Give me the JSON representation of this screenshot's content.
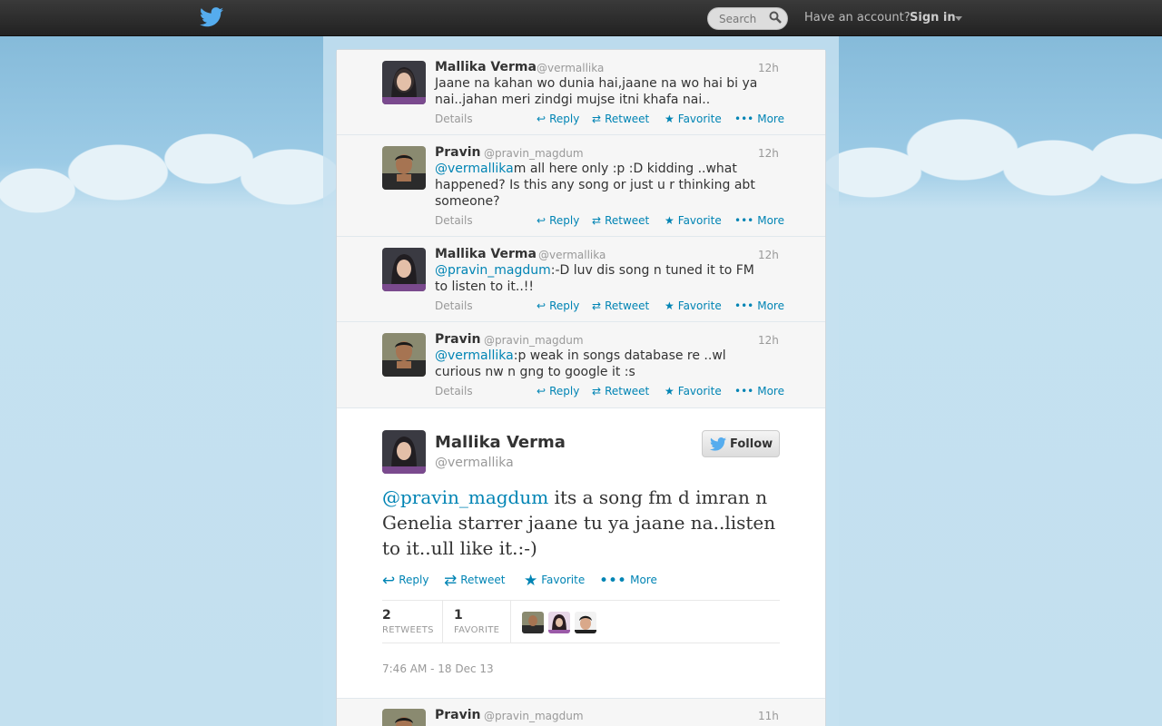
{
  "header": {
    "search_placeholder": "Search",
    "have_account": "Have an account?",
    "signin_label": "Sign in"
  },
  "colors": {
    "link": "#0084b4",
    "topbar": "#2a2a2a"
  },
  "tweets": [
    {
      "name": "Mallika Verma",
      "handle": "@vermallika",
      "time": "12h",
      "mention": "",
      "text": "Jaane na kahan wo dunia hai,jaane na wo hai bi ya nai..jahan meri zindgi mujse itni khafa nai..",
      "details": "Details",
      "reply": "Reply",
      "retweet": "Retweet",
      "favorite": "Favorite",
      "more": "More"
    },
    {
      "name": "Pravin",
      "handle": "@pravin_magdum",
      "time": "12h",
      "mention": "@vermallika",
      "text": "m all here only :p :D kidding ..what happened? Is this any song or just u r thinking abt someone?",
      "details": "Details",
      "reply": "Reply",
      "retweet": "Retweet",
      "favorite": "Favorite",
      "more": "More"
    },
    {
      "name": "Mallika Verma",
      "handle": "@vermallika",
      "time": "12h",
      "mention": "@pravin_magdum",
      "text": ":-D luv dis song n tuned it to FM to listen to it..!!",
      "details": "Details",
      "reply": "Reply",
      "retweet": "Retweet",
      "favorite": "Favorite",
      "more": "More"
    },
    {
      "name": "Pravin",
      "handle": "@pravin_magdum",
      "time": "12h",
      "mention": "@vermallika",
      "text": ":p weak in songs database re ..wl curious nw n gng to google it :s",
      "details": "Details",
      "reply": "Reply",
      "retweet": "Retweet",
      "favorite": "Favorite",
      "more": "More"
    }
  ],
  "main_tweet": {
    "name": "Mallika Verma",
    "handle": "@vermallika",
    "follow_label": "Follow",
    "mention": "@pravin_magdum",
    "text": " its a song fm d imran n Genelia starrer jaane tu ya jaane na..listen to it..ull like it.:-)",
    "reply": "Reply",
    "retweet": "Retweet",
    "favorite": "Favorite",
    "more": "More",
    "retweets_count": "2",
    "retweets_label": "RETWEETS",
    "favorites_count": "1",
    "favorites_label": "FAVORITE",
    "timestamp": "7:46 AM - 18 Dec 13"
  },
  "bottom_tweet": {
    "name": "Pravin",
    "handle": "@pravin_magdum",
    "time": "11h"
  }
}
